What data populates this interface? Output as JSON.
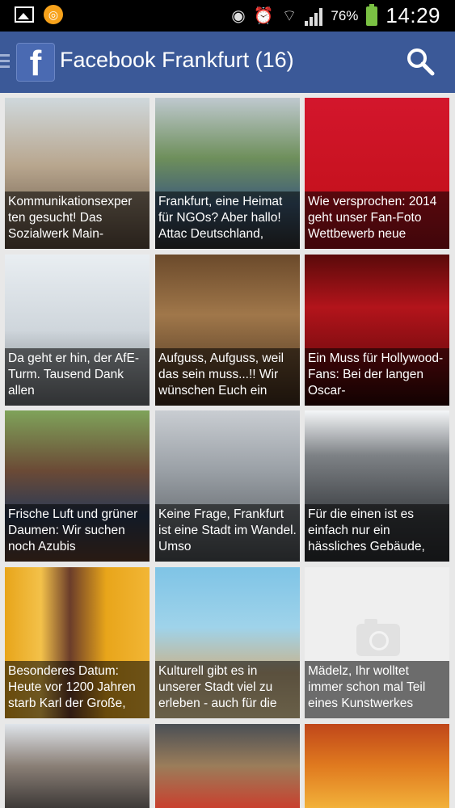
{
  "status_bar": {
    "battery": "76%",
    "time": "14:29"
  },
  "header": {
    "title": "Facebook Frankfurt (16)",
    "logo_letter": "f",
    "color": "#3b5998"
  },
  "posts": [
    {
      "caption": "Kommunikationsexper ten gesucht! Das Sozialwerk Main-",
      "bg": "linear-gradient(180deg,#cfd8dc 0%,#b8a68e 45%,#5a4a3c 100%)"
    },
    {
      "caption": "Frankfurt, eine Heimat für NGOs? Aber hallo! Attac Deutschland,",
      "bg": "linear-gradient(180deg,#bfc9cf 0%,#6e8f5b 40%,#3f5d7a 70%,#2e2e2e 100%)"
    },
    {
      "caption": "Wie versprochen: 2014 geht unser Fan-Foto Wettbewerb neue",
      "bg": "linear-gradient(180deg,#d3162c 0%,#c7121f 60%,#8e0f18 100%)"
    },
    {
      "caption": "Da geht er hin, der AfE-Turm. Tausend Dank allen",
      "bg": "linear-gradient(180deg,#e9eef2 0%,#cfd6dc 50%,#6b6f73 100%)"
    },
    {
      "caption": "Aufguss, Aufguss, weil das sein muss...!! Wir wünschen Euch ein",
      "bg": "linear-gradient(180deg,#6b4a2b 0%,#a0774a 40%,#3d2a1a 100%)"
    },
    {
      "caption": "Ein Muss für Hollywood-Fans: Bei der langen Oscar-",
      "bg": "linear-gradient(180deg,#5a0a0a 0%,#b3141b 35%,#7a0c10 70%,#2a0505 100%)"
    },
    {
      "caption": "Frische Luft und grüner Daumen: Wir suchen noch Azubis",
      "bg": "linear-gradient(180deg,#7fa35a 0%,#6b4a36 40%,#2a3a55 70%,#5b3a2a 100%)"
    },
    {
      "caption": "Keine Frage, Frankfurt ist eine Stadt im Wandel. Umso",
      "bg": "linear-gradient(180deg,#c9cdd2 0%,#9aa0a6 40%,#4b4f53 100%)"
    },
    {
      "caption": "Für die einen ist es einfach nur ein hässliches Gebäude,",
      "bg": "linear-gradient(180deg,#f4f6f8 0%,#7d8185 30%,#3e4145 70%,#2c2e31 100%)"
    },
    {
      "caption": "Besonderes Datum: Heute vor 1200 Jahren starb Karl der Große,",
      "bg": "linear-gradient(90deg,#e8a51a 0%,#f3c14a 25%,#6b3d2a 45%,#e8a51a 70%,#f2b635 100%)"
    },
    {
      "caption": "Kulturell gibt es in unserer Stadt viel zu erleben - auch für die",
      "bg": "linear-gradient(180deg,#7fc4e6 0%,#9fd3ea 40%,#c9b28a 70%,#e9d4a0 100%)"
    },
    {
      "caption": "Mädelz, Ihr wolltet immer schon mal Teil eines Kunstwerkes",
      "bg": "#efefef",
      "placeholder": true
    },
    {
      "caption": "",
      "bg": "linear-gradient(180deg,#dfe4ea 0%,#8a7f76 50%,#3e3a38 100%)"
    },
    {
      "caption": "",
      "bg": "linear-gradient(180deg,#4a4f55 0%,#9b7d5a 50%,#c9402e 100%)"
    },
    {
      "caption": "",
      "bg": "linear-gradient(180deg,#c0461a 0%,#e07a1f 50%,#f2b13a 100%)"
    }
  ]
}
